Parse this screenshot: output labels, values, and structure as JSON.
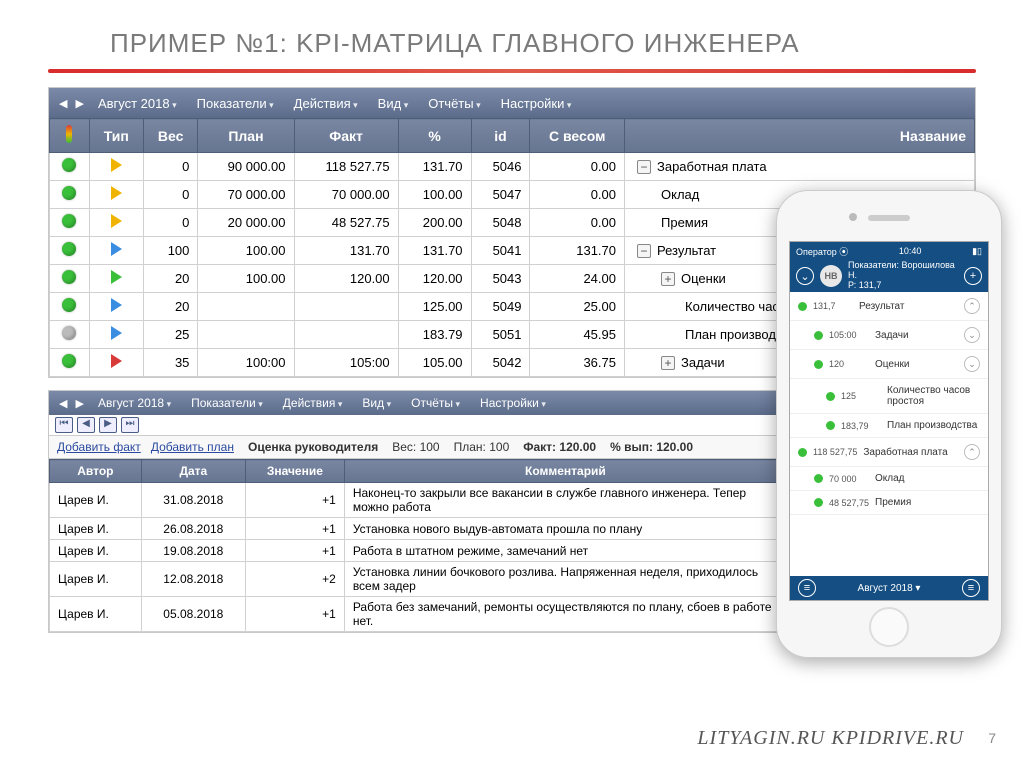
{
  "title": "ПРИМЕР №1: KPI-МАТРИЦА ГЛАВНОГО ИНЖЕНЕРА",
  "footer_sites": "LITYAGIN.RU     KPIDRIVE.RU",
  "page_number": "7",
  "toolbar": {
    "period": "Август 2018",
    "items": [
      "Показатели",
      "Действия",
      "Вид",
      "Отчёты",
      "Настройки"
    ]
  },
  "columns": [
    "",
    "Тип",
    "Вес",
    "План",
    "Факт",
    "%",
    "id",
    "С весом",
    "Название"
  ],
  "rows": [
    {
      "dot": "g",
      "tri": "y",
      "w": "0",
      "plan": "90 000.00",
      "fact": "118 527.75",
      "pct": "131.70",
      "id": "5046",
      "wv": "0.00",
      "exp": "−",
      "name": "Заработная плата",
      "indent": 0
    },
    {
      "dot": "g",
      "tri": "y",
      "w": "0",
      "plan": "70 000.00",
      "fact": "70 000.00",
      "pct": "100.00",
      "id": "5047",
      "wv": "0.00",
      "exp": "",
      "name": "Оклад",
      "indent": 1
    },
    {
      "dot": "g",
      "tri": "y",
      "w": "0",
      "plan": "20 000.00",
      "fact": "48 527.75",
      "pct": "200.00",
      "id": "5048",
      "wv": "0.00",
      "exp": "",
      "name": "Премия",
      "indent": 1
    },
    {
      "dot": "g",
      "tri": "b",
      "w": "100",
      "plan": "100.00",
      "fact": "131.70",
      "pct": "131.70",
      "id": "5041",
      "wv": "131.70",
      "exp": "−",
      "name": "Результат",
      "indent": 0
    },
    {
      "dot": "g",
      "tri": "g",
      "w": "20",
      "plan": "100.00",
      "fact": "120.00",
      "pct": "120.00",
      "id": "5043",
      "wv": "24.00",
      "exp": "+",
      "name": "Оценки",
      "indent": 1
    },
    {
      "dot": "g",
      "tri": "b",
      "w": "20",
      "plan": "",
      "fact": "",
      "pct": "125.00",
      "id": "5049",
      "wv": "25.00",
      "exp": "",
      "name": "Количество часов пр",
      "indent": 2
    },
    {
      "dot": "x",
      "tri": "b",
      "w": "25",
      "plan": "",
      "fact": "",
      "pct": "183.79",
      "id": "5051",
      "wv": "45.95",
      "exp": "",
      "name": "План производства",
      "indent": 2
    },
    {
      "dot": "g",
      "tri": "r",
      "w": "35",
      "plan": "100:00",
      "fact": "105:00",
      "pct": "105.00",
      "id": "5042",
      "wv": "36.75",
      "exp": "+",
      "name": "Задачи",
      "indent": 1
    }
  ],
  "detail": {
    "title_label": "Оценка руководителя",
    "weight_label": "Вес:",
    "weight": "100",
    "plan_label": "План:",
    "plan": "100",
    "fact_label": "Факт:",
    "fact": "120.00",
    "pct_label": "% вып:",
    "pct": "120.00",
    "add_fact": "Добавить факт",
    "add_plan": "Добавить план",
    "columns": [
      "Автор",
      "Дата",
      "Значение",
      "Комментарий"
    ],
    "rows": [
      {
        "a": "Царев И.",
        "d": "31.08.2018",
        "v": "+1",
        "c": "Наконец-то закрыли все вакансии в службе главного инженера. Тепер можно работа"
      },
      {
        "a": "Царев И.",
        "d": "26.08.2018",
        "v": "+1",
        "c": "Установка нового выдув-автомата прошла по плану"
      },
      {
        "a": "Царев И.",
        "d": "19.08.2018",
        "v": "+1",
        "c": "Работа в штатном режиме, замечаний нет"
      },
      {
        "a": "Царев И.",
        "d": "12.08.2018",
        "v": "+2",
        "c": "Установка линии бочкового розлива. Напряженная неделя, приходилось всем задер"
      },
      {
        "a": "Царев И.",
        "d": "05.08.2018",
        "v": "+1",
        "c": "Работа без замечаний, ремонты осуществляются по плану, сбоев в работе нет."
      }
    ]
  },
  "phone": {
    "operator": "Оператор",
    "time": "10:40",
    "avatar": "НВ",
    "header1": "Показатели: Ворошилова Н.",
    "header2": "Р: 131,7",
    "items": [
      {
        "v": "131,7",
        "n": "Результат",
        "indent": 0,
        "chev": "up"
      },
      {
        "v": "105:00",
        "n": "Задачи",
        "indent": 1,
        "chev": "down"
      },
      {
        "v": "120",
        "n": "Оценки",
        "indent": 1,
        "chev": "down"
      },
      {
        "v": "125",
        "n": "Количество часов простоя",
        "indent": 2,
        "chev": ""
      },
      {
        "v": "183,79",
        "n": "План производства",
        "indent": 2,
        "chev": ""
      },
      {
        "v": "118 527,75",
        "n": "Заработная плата",
        "indent": 0,
        "chev": "up"
      },
      {
        "v": "70 000",
        "n": "Оклад",
        "indent": 1,
        "chev": ""
      },
      {
        "v": "48 527,75",
        "n": "Премия",
        "indent": 1,
        "chev": ""
      }
    ],
    "footer_period": "Август 2018"
  }
}
